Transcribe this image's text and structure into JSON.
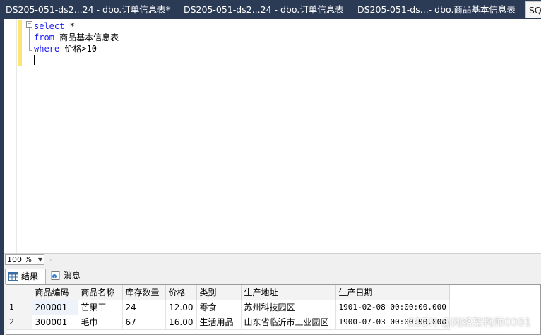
{
  "tabs": [
    {
      "label": "DS205-051-ds2...24 - dbo.订单信息表*",
      "active": false
    },
    {
      "label": "DS205-051-ds2...24 - dbo.订单信息表",
      "active": false
    },
    {
      "label": "DS205-051-ds...- dbo.商品基本信息表",
      "active": false
    },
    {
      "label": "SQ",
      "active": true
    }
  ],
  "editor": {
    "collapse_symbol": "−",
    "lines": [
      {
        "keyword": "select",
        "rest": " *"
      },
      {
        "keyword": "from",
        "rest": " 商品基本信息表"
      },
      {
        "keyword": "where",
        "rest": " 价格>10"
      }
    ]
  },
  "zoom": {
    "value": "100 %"
  },
  "results_tabs": {
    "results": "结果",
    "messages": "消息"
  },
  "grid": {
    "columns": [
      "商品编码",
      "商品名称",
      "库存数量",
      "价格",
      "类别",
      "生产地址",
      "生产日期"
    ],
    "rows": [
      {
        "n": "1",
        "cells": [
          "200001",
          "芒果干",
          "24",
          "12.00",
          "零食",
          "苏州科技园区",
          "1901-02-08 00:00:00.000"
        ]
      },
      {
        "n": "2",
        "cells": [
          "300001",
          "毛巾",
          "67",
          "16.00",
          "生活用品",
          "山东省临沂市工业园区",
          "1900-07-03 00:00:00.000"
        ]
      }
    ]
  },
  "watermark": "CSDN @网络架构师0001",
  "colors": {
    "chrome": "#2b3a55",
    "keyword": "#1b1bf5",
    "change_bar": "#fbe573"
  }
}
